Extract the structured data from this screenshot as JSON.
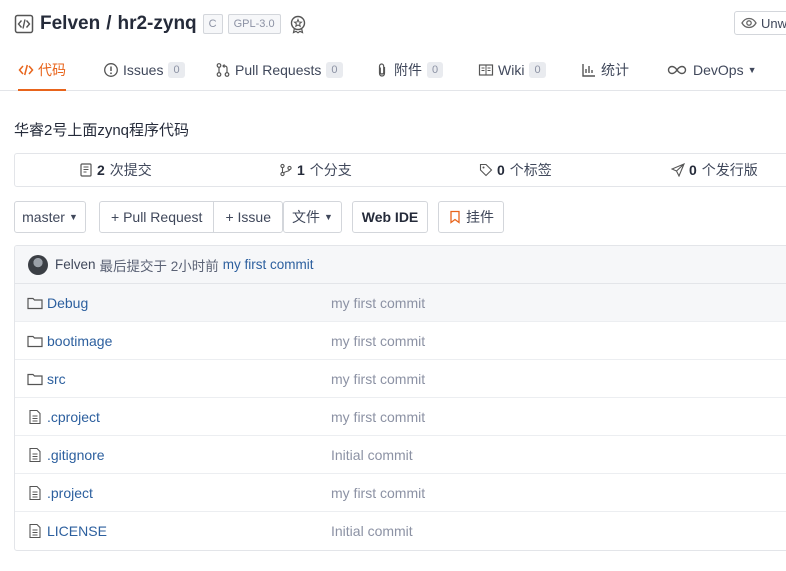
{
  "repo": {
    "owner": "Felven",
    "separator": "/",
    "name": "hr2-zynq",
    "tags": [
      "C",
      "GPL-3.0"
    ],
    "watch_label": "Unw"
  },
  "tabs": [
    {
      "label": "代码",
      "icon": "code-icon",
      "active": true
    },
    {
      "label": "Issues",
      "icon": "issue-icon",
      "count": "0"
    },
    {
      "label": "Pull Requests",
      "icon": "pull-request-icon",
      "count": "0"
    },
    {
      "label": "附件",
      "icon": "attachment-icon",
      "count": "0"
    },
    {
      "label": "Wiki",
      "icon": "book-icon",
      "count": "0"
    },
    {
      "label": "统计",
      "icon": "bar-chart-icon"
    },
    {
      "label": "DevOps",
      "icon": "infinity-icon"
    }
  ],
  "description": "华睿2号上面zynq程序代码",
  "stats": [
    {
      "num": "2",
      "label": "次提交",
      "icon": "commit-file-icon"
    },
    {
      "num": "1",
      "label": "个分支",
      "icon": "branch-icon"
    },
    {
      "num": "0",
      "label": "个标签",
      "icon": "tag-icon"
    },
    {
      "num": "0",
      "label": "个发行版",
      "icon": "release-icon"
    }
  ],
  "actions": {
    "branch": "master",
    "pull_request": "+ Pull Request",
    "issue": "+ Issue",
    "files": "文件",
    "web_ide": "Web IDE",
    "widget": "挂件"
  },
  "last_commit": {
    "author": "Felven",
    "text": "最后提交于 2小时前",
    "message": "my first commit"
  },
  "files": [
    {
      "name": "Debug",
      "type": "folder",
      "message": "my first commit"
    },
    {
      "name": "bootimage",
      "type": "folder",
      "message": "my first commit"
    },
    {
      "name": "src",
      "type": "folder",
      "message": "my first commit"
    },
    {
      "name": ".cproject",
      "type": "file",
      "message": "my first commit"
    },
    {
      "name": ".gitignore",
      "type": "file",
      "message": "Initial commit"
    },
    {
      "name": ".project",
      "type": "file",
      "message": "my first commit"
    },
    {
      "name": "LICENSE",
      "type": "file",
      "message": "Initial commit"
    }
  ]
}
